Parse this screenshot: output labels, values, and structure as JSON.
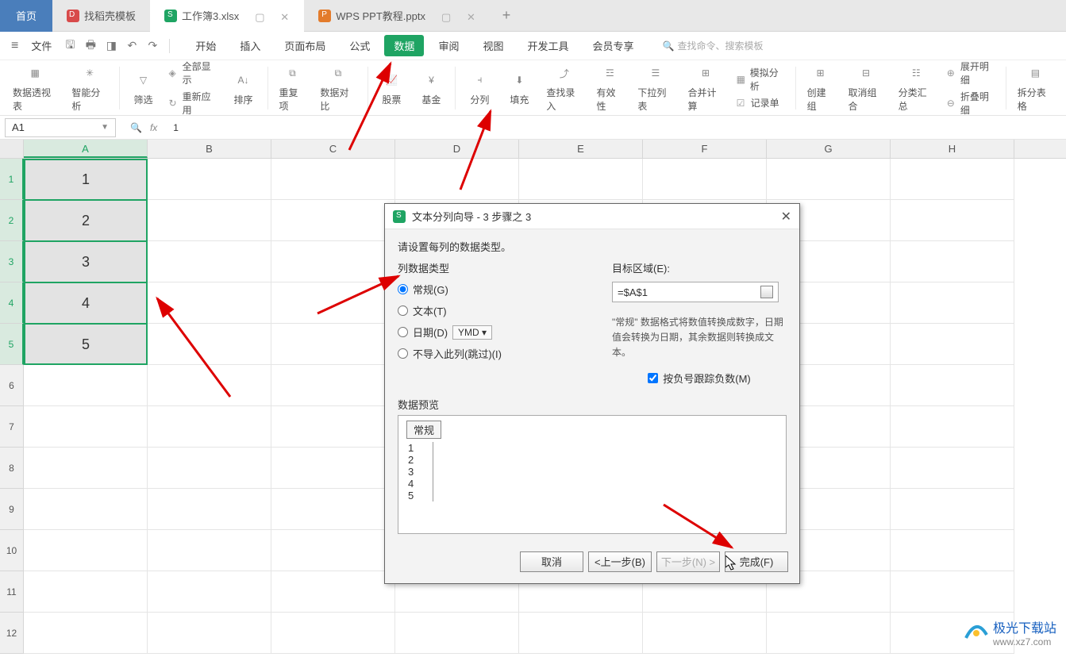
{
  "tabs": {
    "home": "首页",
    "template": "找稻壳模板",
    "workbook": "工作簿3.xlsx",
    "ppt": "WPS PPT教程.pptx"
  },
  "menubar": {
    "file": "文件",
    "items": [
      "开始",
      "插入",
      "页面布局",
      "公式",
      "数据",
      "审阅",
      "视图",
      "开发工具",
      "会员专享"
    ],
    "active_index": 4,
    "search_placeholder": "查找命令、搜索模板"
  },
  "ribbon": {
    "pivot": "数据透视表",
    "smart": "智能分析",
    "filter": "筛选",
    "show_all": "全部显示",
    "reapply": "重新应用",
    "sort": "排序",
    "dup": "重复项",
    "compare": "数据对比",
    "stock": "股票",
    "fund": "基金",
    "split": "分列",
    "fill": "填充",
    "lookup": "查找录入",
    "validity": "有效性",
    "dropdown": "下拉列表",
    "merge": "合并计算",
    "simulate": "模拟分析",
    "record": "记录单",
    "group_create": "创建组",
    "group_cancel": "取消组合",
    "subtotal": "分类汇总",
    "expand": "展开明细",
    "collapse": "折叠明细",
    "split_table": "拆分表格"
  },
  "formula": {
    "namebox": "A1",
    "value": "1"
  },
  "columns": [
    "A",
    "B",
    "C",
    "D",
    "E",
    "F",
    "G",
    "H"
  ],
  "rows": [
    "1",
    "2",
    "3",
    "4",
    "5",
    "6",
    "7",
    "8",
    "9",
    "10",
    "11",
    "12"
  ],
  "cell_values": [
    "1",
    "2",
    "3",
    "4",
    "5"
  ],
  "dialog": {
    "title": "文本分列向导 - 3 步骤之 3",
    "instruction": "请设置每列的数据类型。",
    "col_type_label": "列数据类型",
    "radio_general": "常规(G)",
    "radio_text": "文本(T)",
    "radio_date": "日期(D)",
    "date_format": "YMD",
    "radio_skip": "不导入此列(跳过)(I)",
    "target_label": "目标区域(E):",
    "target_value": "=$A$1",
    "hint": "\"常规\" 数据格式将数值转换成数字，日期值会转换为日期，其余数据则转换成文本。",
    "checkbox": "按负号跟踪负数(M)",
    "preview_label": "数据预览",
    "preview_header": "常规",
    "preview_rows": [
      "1",
      "2",
      "3",
      "4",
      "5"
    ],
    "btn_cancel": "取消",
    "btn_prev": "<上一步(B)",
    "btn_next": "下一步(N) >",
    "btn_finish": "完成(F)"
  },
  "watermark": {
    "title": "极光下载站",
    "url": "www.xz7.com"
  }
}
